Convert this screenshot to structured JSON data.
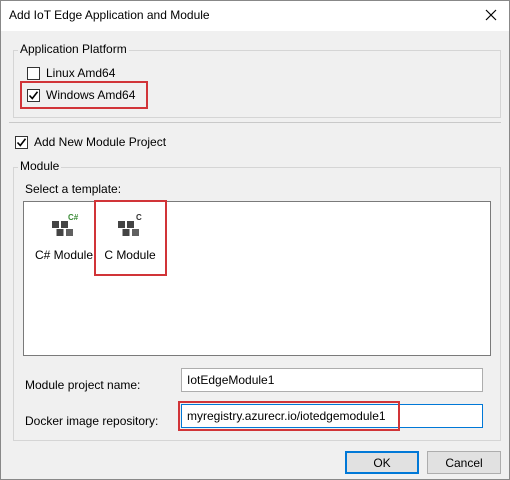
{
  "window": {
    "title": "Add IoT Edge Application and Module"
  },
  "platform": {
    "legend": "Application Platform",
    "options": [
      {
        "label": "Linux Amd64",
        "checked": false
      },
      {
        "label": "Windows Amd64",
        "checked": true
      }
    ]
  },
  "add_module": {
    "label": "Add New Module Project",
    "checked": true
  },
  "module": {
    "legend": "Module",
    "template_label": "Select a template:",
    "templates": [
      {
        "label": "C# Module",
        "badge": "C#",
        "icon": "csharp-module-icon"
      },
      {
        "label": "C Module",
        "badge": "C",
        "icon": "c-module-icon"
      }
    ],
    "project_name_label": "Module project name:",
    "project_name_value": "IotEdgeModule1",
    "docker_label": "Docker image repository:",
    "docker_value": "myregistry.azurecr.io/iotedgemodule1"
  },
  "buttons": {
    "ok": "OK",
    "cancel": "Cancel"
  },
  "colors": {
    "highlight": "#d13438",
    "accent": "#0078d7"
  }
}
